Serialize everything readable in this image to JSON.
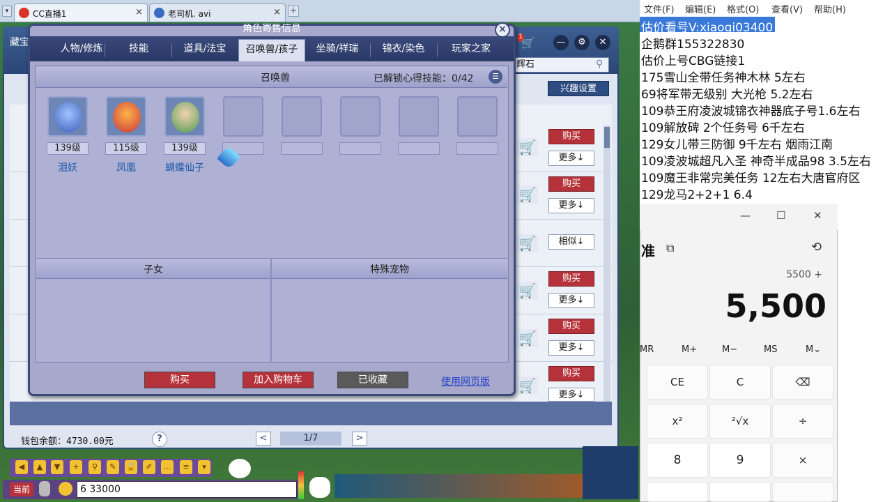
{
  "browser": {
    "tabs": [
      {
        "label": "CC直播1",
        "close": "×"
      },
      {
        "label": "老司机. avi",
        "close": "×"
      }
    ],
    "add_tab": "+",
    "menu_glyph": "▾"
  },
  "shop": {
    "side_label": "藏宝",
    "cart_badge": "1",
    "search_value": "辉石",
    "interest_button": "兴趣设置",
    "buy_label": "购买",
    "more_label": "更多↓",
    "similar_label": "相似↓",
    "wallet": "钱包余额：4730.00元",
    "help": "?",
    "prev": "<",
    "page": "1/7",
    "next": ">"
  },
  "dialog": {
    "title": "角色寄售信息",
    "close": "×",
    "tabs": [
      "人物/修炼",
      "技能",
      "道具/法宝",
      "召唤兽/孩子",
      "坐骑/祥瑞",
      "锦衣/染色",
      "玩家之家"
    ],
    "active_tab": "召唤兽/孩子",
    "panel_title": "召唤兽",
    "unlock_text": "已解锁心得技能：0/42",
    "pets": [
      {
        "level": "139级",
        "name": "泪妖",
        "color": "#5a78c8",
        "icon": "teardemon-icon"
      },
      {
        "level": "115级",
        "name": "凤凰",
        "color": "#c8463a",
        "icon": "phoenix-icon"
      },
      {
        "level": "139级",
        "name": "蝴蝶仙子",
        "color": "#5aa05a",
        "icon": "butterfly-fairy-icon"
      }
    ],
    "children_label": "子女",
    "special_label": "特殊宠物",
    "buttons": {
      "buy": "购买",
      "add_cart": "加入购物车",
      "favorited": "已收藏"
    },
    "web_link": "使用网页版"
  },
  "game_bar": {
    "current": "当前",
    "chat_value": "6 33000"
  },
  "notepad": {
    "menu": [
      "文件(F)",
      "编辑(E)",
      "格式(O)",
      "查看(V)",
      "帮助(H)"
    ],
    "lines": [
      "估价看号V:xiaoqi03400",
      "企鹅群155322830",
      "估价上号CBG链接1",
      "175雪山全带任务神木林 5左右",
      "69将军带无级别 大光枪 5.2左右",
      "109恭王府凌波城锦衣神器底子号1.6左右",
      "109解放碑 2个任务号 6千左右",
      "129女儿带三防御 9千左右 烟雨江南",
      "109凌波城超凡入圣 神奇半成品98 3.5左右",
      "109魔王非常完美任务 12左右大唐官府区",
      "129龙马2+2+1  6.4"
    ]
  },
  "calculator": {
    "mode_label": "准",
    "expression": "5500 +",
    "display": "5,500",
    "memory": [
      "MR",
      "M+",
      "M−",
      "MS",
      "M⌄"
    ],
    "keys": [
      "CE",
      "C",
      "⌫",
      "x²",
      "²√x",
      "÷",
      "8",
      "9",
      "×"
    ],
    "win_min": "—",
    "win_max": "☐",
    "win_close": "✕"
  }
}
